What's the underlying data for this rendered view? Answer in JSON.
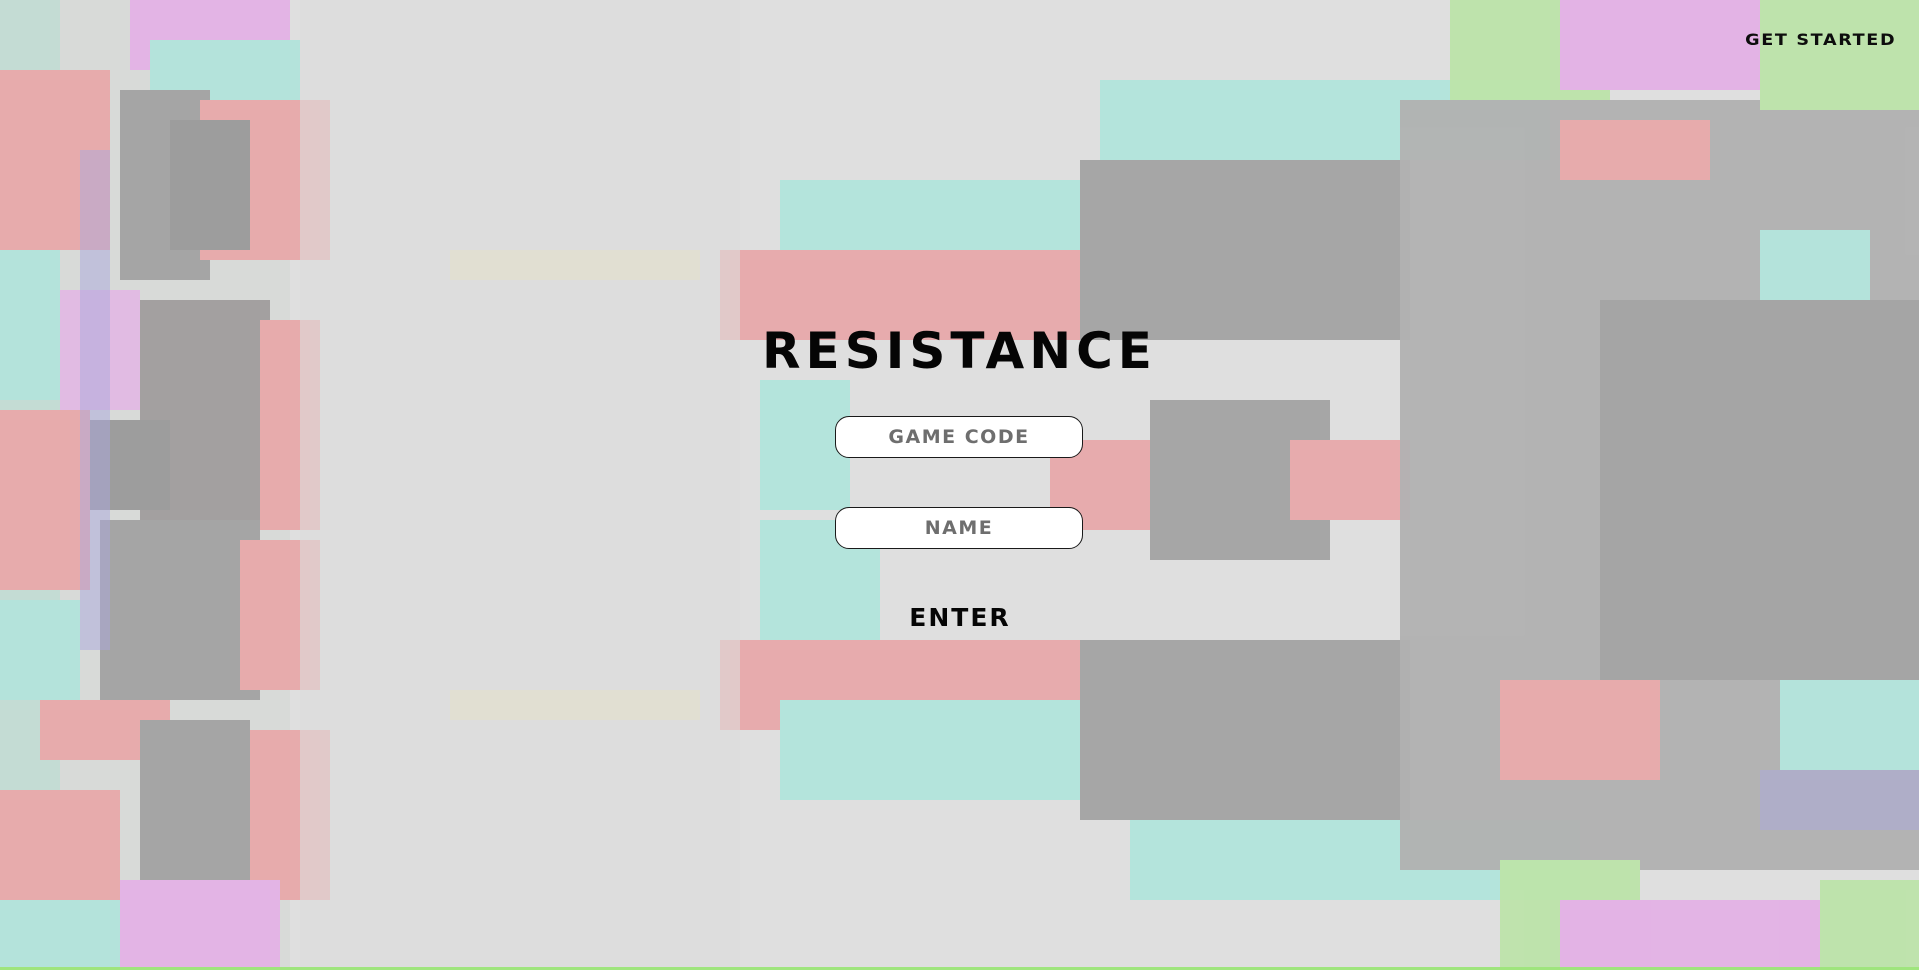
{
  "nav": {
    "get_started_label": "GET STARTED"
  },
  "main": {
    "title": "RESISTANCE",
    "game_code_placeholder": "GAME CODE",
    "name_placeholder": "NAME",
    "enter_label": "ENTER"
  },
  "colors": {
    "background": "#d9d9d9",
    "text": "#050505",
    "glitch_red": "#ec7a7c",
    "glitch_cyan": "#8be5d6",
    "glitch_magenta": "#e58ae8",
    "glitch_green": "#9fe57d",
    "glitch_blue": "#7a73d8",
    "glitch_dark": "#6f6f6f",
    "glitch_yellow": "#f2e68c"
  }
}
